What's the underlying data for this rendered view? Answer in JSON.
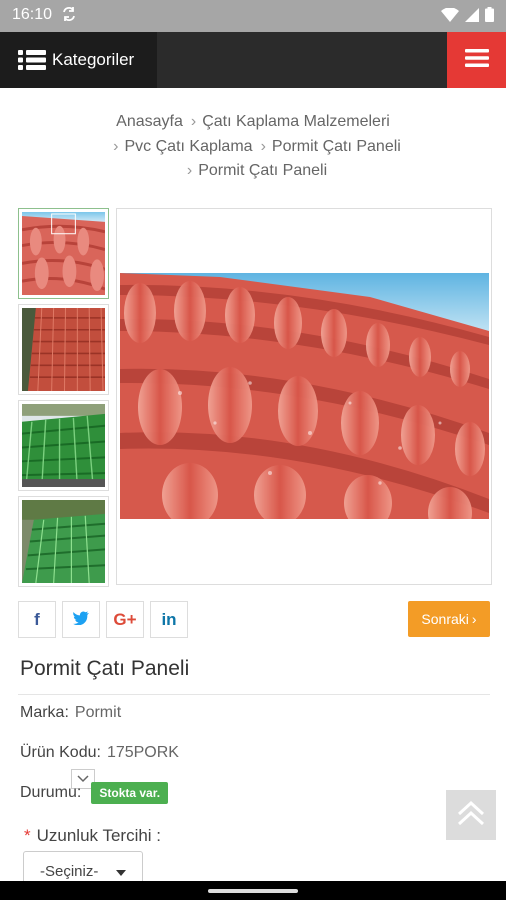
{
  "status_bar": {
    "time": "16:10"
  },
  "topbar": {
    "categories_label": "Kategoriler"
  },
  "breadcrumb": {
    "line1": [
      "Anasayfa",
      "Çatı Kaplama Malzemeleri"
    ],
    "line2": [
      "Pvc Çatı Kaplama",
      "Pormit Çatı Paneli"
    ],
    "line3": [
      "Pormit Çatı Paneli"
    ]
  },
  "gallery": {
    "thumbnails": [
      "red-roof-tiles-closeup",
      "red-roof-tiles-sheet",
      "green-roof-tiles-installed",
      "green-roof-tiles-house"
    ],
    "main_image": "red-roof-tiles-closeup"
  },
  "social": [
    "f",
    "t",
    "G+",
    "in"
  ],
  "next_button": {
    "label": "Sonraki"
  },
  "product": {
    "title": "Pormit Çatı Paneli",
    "brand_label": "Marka:",
    "brand_value": "Pormit",
    "code_label": "Ürün Kodu:",
    "code_value": "175PORK",
    "status_label": "Durumu:",
    "status_value": "Stokta var."
  },
  "options": {
    "length_label": "Uzunluk Tercihi :",
    "length_selected": "-Seçiniz-"
  },
  "colors": {
    "accent_red": "#e53935",
    "next_orange": "#f39c26",
    "stock_green": "#4caf50",
    "topbar_dark": "#2b2b2b"
  }
}
